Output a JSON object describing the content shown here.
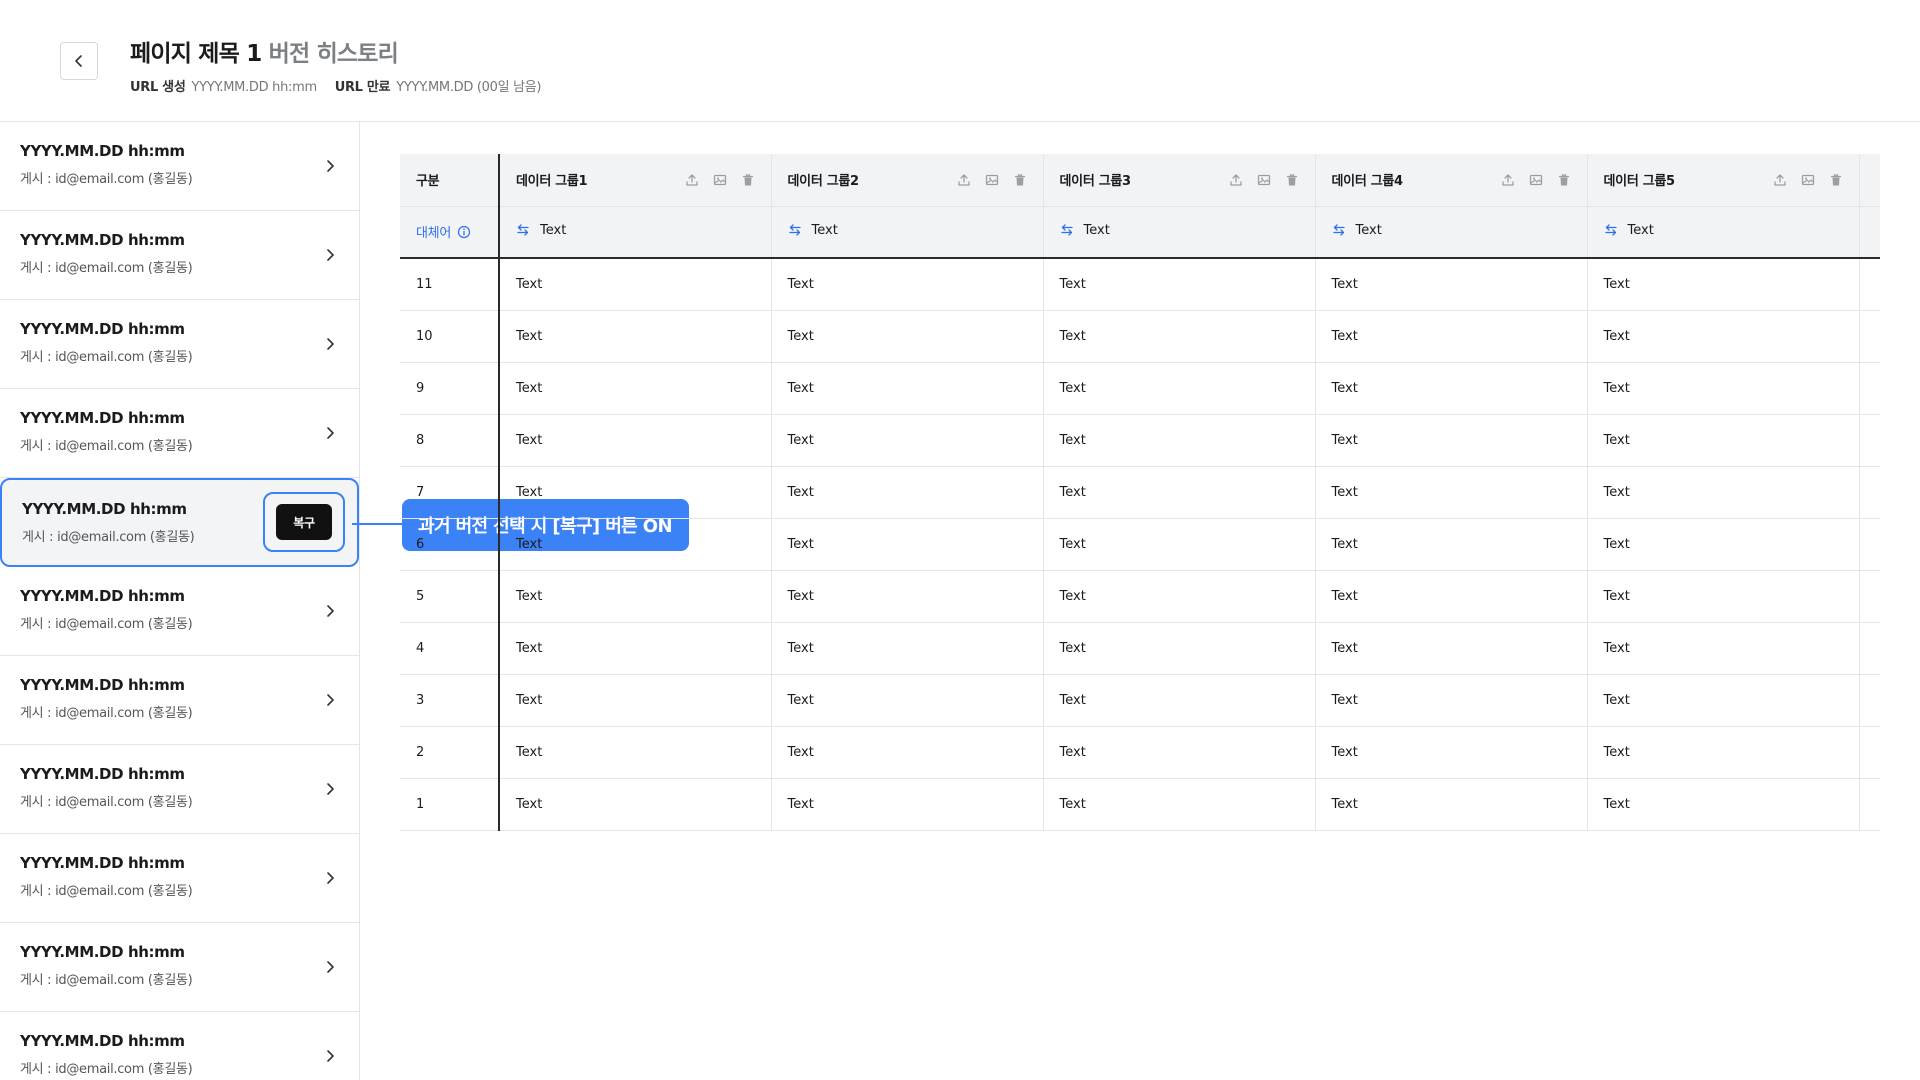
{
  "header": {
    "title": "페이지 제목 1",
    "subtitle": "버전 히스토리",
    "url_created_label": "URL 생성",
    "url_created_value": "YYYY.MM.DD hh:mm",
    "url_expiry_label": "URL 만료",
    "url_expiry_value": "YYYY.MM.DD (00일 남음)"
  },
  "sidebar": {
    "items": [
      {
        "date": "YYYY.MM.DD hh:mm",
        "poster": "게시 : id@email.com (홍길동)"
      },
      {
        "date": "YYYY.MM.DD hh:mm",
        "poster": "게시 : id@email.com (홍길동)"
      },
      {
        "date": "YYYY.MM.DD hh:mm",
        "poster": "게시 : id@email.com (홍길동)"
      },
      {
        "date": "YYYY.MM.DD hh:mm",
        "poster": "게시 : id@email.com (홍길동)"
      },
      {
        "date": "YYYY.MM.DD hh:mm",
        "poster": "게시 : id@email.com (홍길동)",
        "selected": true,
        "restore_label": "복구"
      },
      {
        "date": "YYYY.MM.DD hh:mm",
        "poster": "게시 : id@email.com (홍길동)"
      },
      {
        "date": "YYYY.MM.DD hh:mm",
        "poster": "게시 : id@email.com (홍길동)"
      },
      {
        "date": "YYYY.MM.DD hh:mm",
        "poster": "게시 : id@email.com (홍길동)"
      },
      {
        "date": "YYYY.MM.DD hh:mm",
        "poster": "게시 : id@email.com (홍길동)"
      },
      {
        "date": "YYYY.MM.DD hh:mm",
        "poster": "게시 : id@email.com (홍길동)"
      },
      {
        "date": "YYYY.MM.DD hh:mm",
        "poster": "게시 : id@email.com (홍길동)"
      }
    ]
  },
  "annotation": {
    "text": "과거 버전 선택 시 [복구] 버튼 ON",
    "color": "#3b82f6"
  },
  "table": {
    "row_header_label": "구분",
    "alias_label": "대체어",
    "groups": [
      {
        "name": "데이터 그룹1",
        "alias": "Text"
      },
      {
        "name": "데이터 그룹2",
        "alias": "Text"
      },
      {
        "name": "데이터 그룹3",
        "alias": "Text"
      },
      {
        "name": "데이터 그룹4",
        "alias": "Text"
      },
      {
        "name": "데이터 그룹5",
        "alias": "Text"
      }
    ],
    "group_icons": [
      "upload-icon",
      "image-icon",
      "trash-icon"
    ],
    "rows": [
      {
        "label": "11",
        "cells": [
          "Text",
          "Text",
          "Text",
          "Text",
          "Text"
        ]
      },
      {
        "label": "10",
        "cells": [
          "Text",
          "Text",
          "Text",
          "Text",
          "Text"
        ]
      },
      {
        "label": "9",
        "cells": [
          "Text",
          "Text",
          "Text",
          "Text",
          "Text"
        ]
      },
      {
        "label": "8",
        "cells": [
          "Text",
          "Text",
          "Text",
          "Text",
          "Text"
        ]
      },
      {
        "label": "7",
        "cells": [
          "Text",
          "Text",
          "Text",
          "Text",
          "Text"
        ]
      },
      {
        "label": "6",
        "cells": [
          "Text",
          "Text",
          "Text",
          "Text",
          "Text"
        ]
      },
      {
        "label": "5",
        "cells": [
          "Text",
          "Text",
          "Text",
          "Text",
          "Text"
        ]
      },
      {
        "label": "4",
        "cells": [
          "Text",
          "Text",
          "Text",
          "Text",
          "Text"
        ]
      },
      {
        "label": "3",
        "cells": [
          "Text",
          "Text",
          "Text",
          "Text",
          "Text"
        ]
      },
      {
        "label": "2",
        "cells": [
          "Text",
          "Text",
          "Text",
          "Text",
          "Text"
        ]
      },
      {
        "label": "1",
        "cells": [
          "Text",
          "Text",
          "Text",
          "Text",
          "Text"
        ]
      }
    ]
  },
  "colors": {
    "accent": "#3b82f6",
    "alias_link": "#2f6fec",
    "restore_button": "#111111",
    "header_bg": "#f1f3f5"
  }
}
